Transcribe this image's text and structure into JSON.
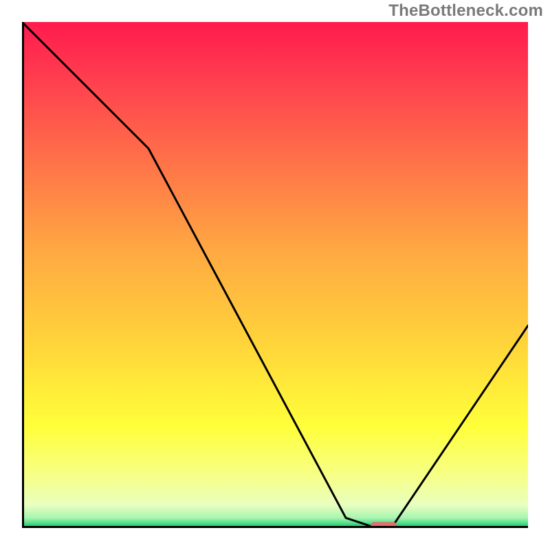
{
  "watermark": "TheBottleneck.com",
  "chart_data": {
    "type": "line",
    "title": "",
    "xlabel": "",
    "ylabel": "",
    "xlim": [
      0,
      100
    ],
    "ylim": [
      0,
      100
    ],
    "grid": false,
    "legend": false,
    "x": [
      0,
      25,
      64,
      70,
      73,
      100
    ],
    "values": [
      100,
      75,
      2,
      0,
      0,
      40
    ],
    "annotations": [
      {
        "type": "marker",
        "shape": "pill",
        "x": 71.5,
        "y": 0.5,
        "color": "#e46d6d"
      }
    ],
    "background_gradient": {
      "stops": [
        {
          "pos": 0.0,
          "color": "#ff1a4d"
        },
        {
          "pos": 0.1,
          "color": "#ff3a4f"
        },
        {
          "pos": 0.25,
          "color": "#ff6a4a"
        },
        {
          "pos": 0.45,
          "color": "#ffa842"
        },
        {
          "pos": 0.65,
          "color": "#ffd83a"
        },
        {
          "pos": 0.8,
          "color": "#ffff3a"
        },
        {
          "pos": 0.9,
          "color": "#f6ff8a"
        },
        {
          "pos": 0.955,
          "color": "#e8ffc0"
        },
        {
          "pos": 0.98,
          "color": "#a8f5b0"
        },
        {
          "pos": 1.0,
          "color": "#00c864"
        }
      ]
    }
  }
}
